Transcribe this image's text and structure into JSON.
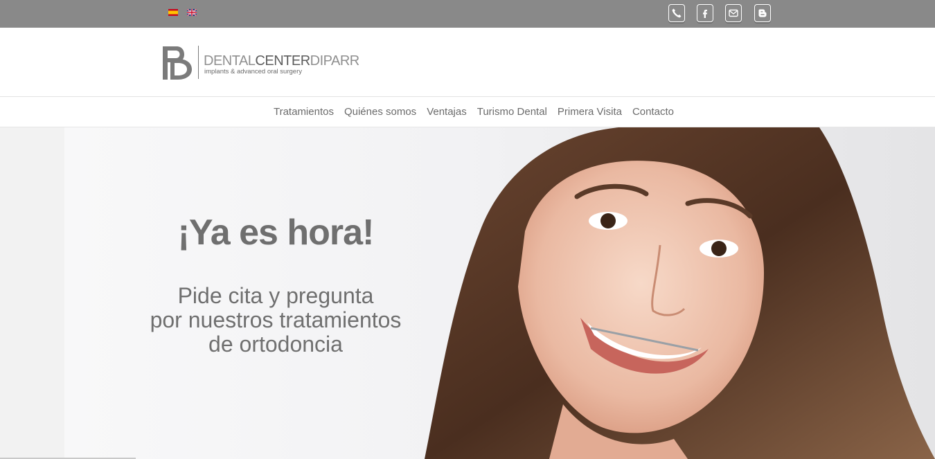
{
  "topbar": {
    "languages": [
      {
        "code": "es",
        "icon": "spain-flag-icon"
      },
      {
        "code": "en",
        "icon": "uk-flag-icon"
      }
    ],
    "social": [
      {
        "icon": "phone-icon"
      },
      {
        "icon": "facebook-icon"
      },
      {
        "icon": "mail-icon"
      },
      {
        "icon": "blogger-icon"
      }
    ],
    "bg_color": "#898989"
  },
  "logo": {
    "mark": "PD",
    "name_part1": "DENTAL",
    "name_part2": "CENTER",
    "name_part3": "DIPARR",
    "tagline": "implants & advanced oral surgery"
  },
  "nav": {
    "items": [
      "Tratamientos",
      "Quiénes somos",
      "Ventajas",
      "Turismo Dental",
      "Primera Visita",
      "Contacto"
    ]
  },
  "hero": {
    "title": "¡Ya es hora!",
    "subtitle_line1": "Pide cita y pregunta",
    "subtitle_line2": "por nuestros tratamientos",
    "subtitle_line3": "de ortodoncia",
    "text_color": "#6f6f6f"
  }
}
